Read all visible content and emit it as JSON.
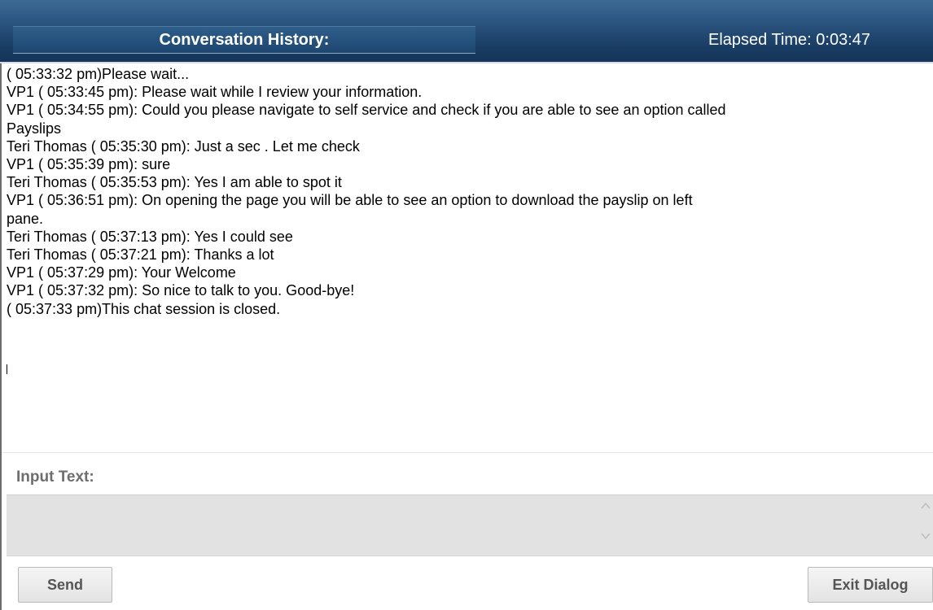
{
  "header": {
    "title": "Conversation History:",
    "elapsed": "Elapsed Time: 0:03:47"
  },
  "transcript": {
    "messages": [
      "( 05:33:32 pm)Please wait...",
      "VP1 ( 05:33:45 pm): Please wait while I review your information.",
      "VP1 ( 05:34:55 pm): Could you please navigate to self service and check if you are able to see an option called",
      "Payslips",
      "Teri Thomas ( 05:35:30 pm): Just a sec . Let me check",
      "VP1 ( 05:35:39 pm): sure",
      "Teri Thomas ( 05:35:53 pm): Yes I am able to spot it",
      "VP1 ( 05:36:51 pm): On opening the page you will be able to see an option to download the payslip on left",
      "pane.",
      "Teri Thomas ( 05:37:13 pm): Yes I could see",
      "Teri Thomas ( 05:37:21 pm): Thanks a lot",
      "VP1 ( 05:37:29 pm): Your Welcome",
      "VP1 ( 05:37:32 pm): So nice to talk to you. Good-bye!",
      "( 05:37:33 pm)This chat session is closed."
    ]
  },
  "input": {
    "label": "Input Text:",
    "value": ""
  },
  "buttons": {
    "send": "Send",
    "exit": "Exit Dialog"
  },
  "icons": {
    "scroll_up": "chevron-up-icon",
    "scroll_down": "chevron-down-icon"
  },
  "colors": {
    "header_dark": "#143457",
    "header_light": "#3d6a95",
    "input_background": "#e2e2e2"
  }
}
